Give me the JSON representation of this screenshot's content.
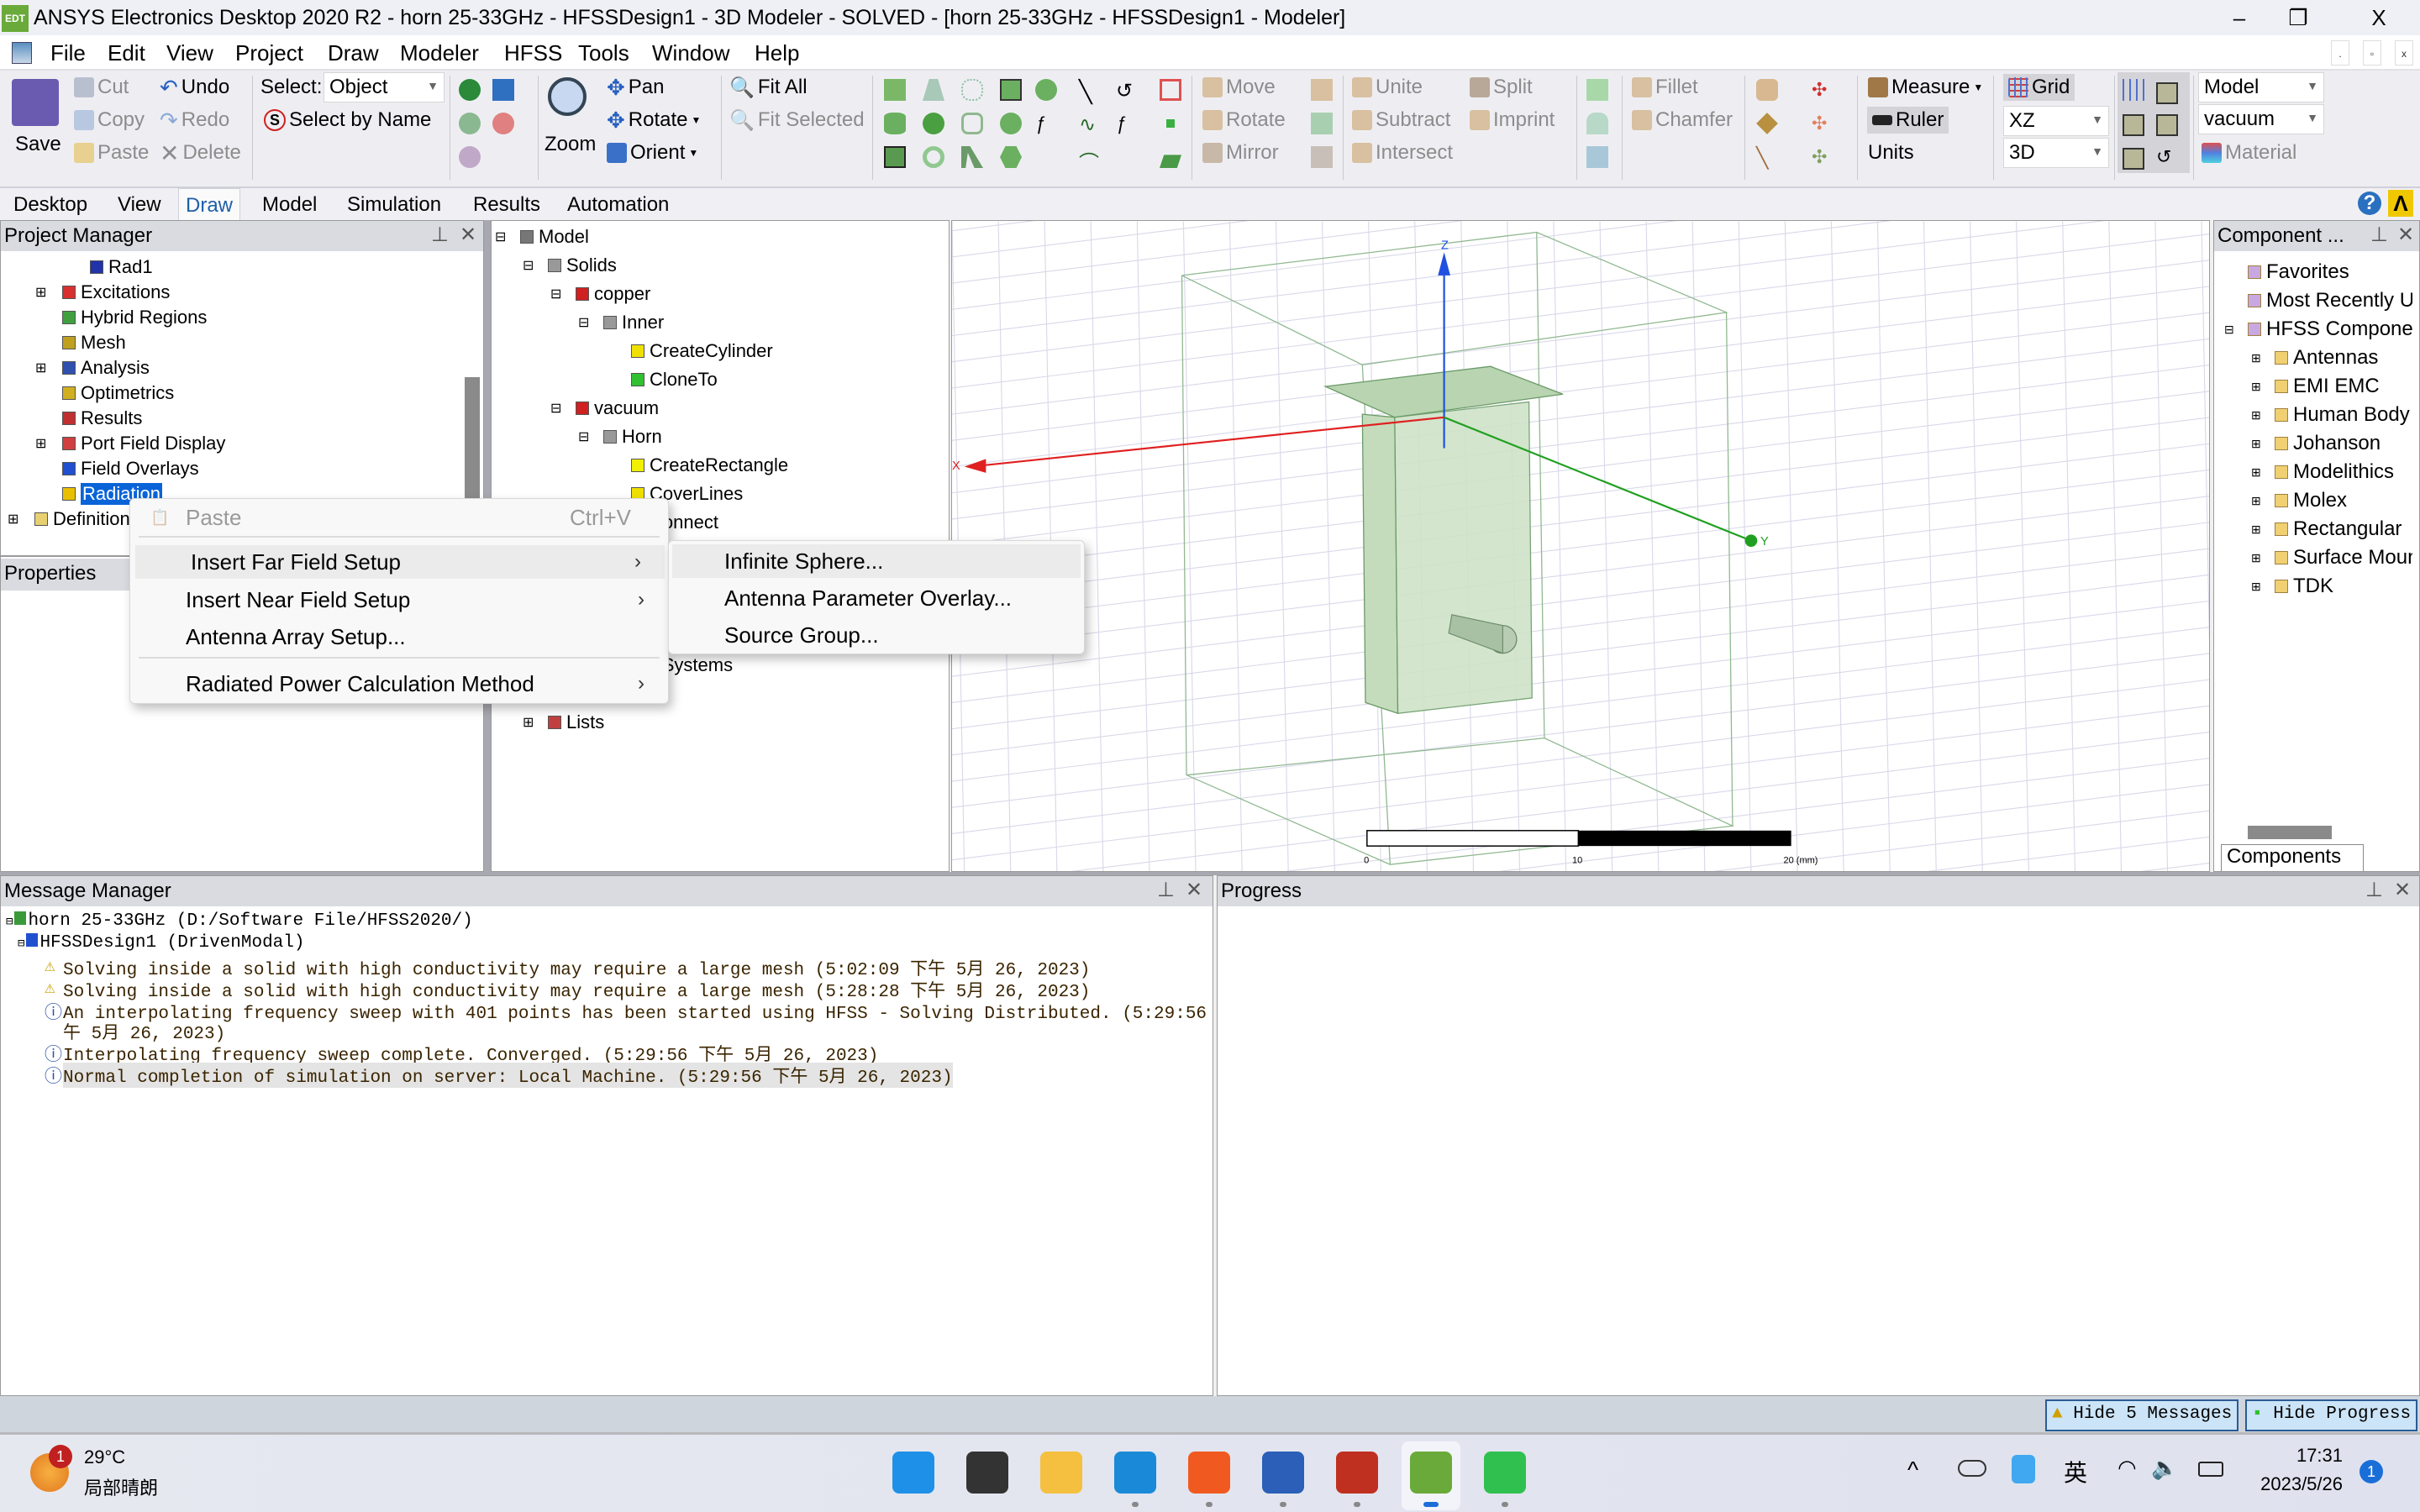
{
  "titlebar": {
    "logo": "EDT",
    "title": "ANSYS Electronics Desktop 2020 R2 - horn 25-33GHz - HFSSDesign1 - 3D Modeler - SOLVED - [horn 25-33GHz - HFSSDesign1 - Modeler]",
    "minimize": "–",
    "restore": "❐",
    "close": "X"
  },
  "menubar": {
    "items": [
      "File",
      "Edit",
      "View",
      "Project",
      "Draw",
      "Modeler",
      "HFSS",
      "Tools",
      "Window",
      "Help"
    ],
    "mdi": [
      ".",
      "▫",
      "x"
    ]
  },
  "ribbon": {
    "save": "Save",
    "cut": "Cut",
    "copy": "Copy",
    "paste": "Paste",
    "undo": "Undo",
    "redo": "Redo",
    "delete": "Delete",
    "select_label": "Select:",
    "select_value": "Object",
    "select_by_name": "Select by Name",
    "zoom": "Zoom",
    "pan": "Pan",
    "rotate": "Rotate",
    "orient": "Orient",
    "fit_all": "Fit All",
    "fit_selected": "Fit Selected",
    "move": "Move",
    "rotate_obj": "Rotate",
    "mirror": "Mirror",
    "unite": "Unite",
    "subtract": "Subtract",
    "intersect": "Intersect",
    "split": "Split",
    "imprint": "Imprint",
    "fillet": "Fillet",
    "chamfer": "Chamfer",
    "measure": "Measure",
    "ruler": "Ruler",
    "units": "Units",
    "grid": "Grid",
    "plane_value": "XZ",
    "dim_value": "3D",
    "view_value": "Model",
    "material_value": "vacuum",
    "material": "Material"
  },
  "tabs": {
    "items": [
      "Desktop",
      "View",
      "Draw",
      "Model",
      "Simulation",
      "Results",
      "Automation"
    ],
    "selected": "Draw"
  },
  "project_manager": {
    "title": "Project Manager",
    "items": [
      {
        "label": "Rad1",
        "depth": 3,
        "icon": "radiation-setup-icon",
        "color": "#2233aa"
      },
      {
        "label": "Excitations",
        "depth": 2,
        "icon": "excitations-icon",
        "color": "#d83030",
        "expand": "+"
      },
      {
        "label": "Hybrid Regions",
        "depth": 2,
        "icon": "hybrid-regions-icon",
        "color": "#40a040"
      },
      {
        "label": "Mesh",
        "depth": 2,
        "icon": "mesh-icon",
        "color": "#c0a020"
      },
      {
        "label": "Analysis",
        "depth": 2,
        "icon": "analysis-icon",
        "color": "#3050b0",
        "expand": "+"
      },
      {
        "label": "Optimetrics",
        "depth": 2,
        "icon": "optimetrics-icon",
        "color": "#d0b020"
      },
      {
        "label": "Results",
        "depth": 2,
        "icon": "results-icon",
        "color": "#c03030"
      },
      {
        "label": "Port Field Display",
        "depth": 2,
        "icon": "port-field-icon",
        "color": "#d04040",
        "expand": "+"
      },
      {
        "label": "Field Overlays",
        "depth": 2,
        "icon": "field-overlays-icon",
        "color": "#2050d0"
      },
      {
        "label": "Radiation",
        "depth": 2,
        "icon": "radiation-icon",
        "color": "#e8c000",
        "selected": true
      },
      {
        "label": "Definitions",
        "depth": 1,
        "icon": "folder-icon",
        "color": "#e8d070",
        "expand": "+"
      }
    ]
  },
  "properties": {
    "title": "Properties"
  },
  "model_tree": {
    "items": [
      {
        "label": "Model",
        "depth": 0,
        "icon": "model-icon",
        "color": "#777",
        "expand": "-"
      },
      {
        "label": "Solids",
        "depth": 1,
        "icon": "solids-icon",
        "color": "#999",
        "expand": "-"
      },
      {
        "label": "copper",
        "depth": 2,
        "icon": "material-icon",
        "color": "#d02020",
        "expand": "-"
      },
      {
        "label": "Inner",
        "depth": 3,
        "icon": "object-icon",
        "color": "#999",
        "expand": "-"
      },
      {
        "label": "CreateCylinder",
        "depth": 4,
        "icon": "cylinder-icon",
        "color": "#f0e000"
      },
      {
        "label": "CloneTo",
        "depth": 4,
        "icon": "clone-icon",
        "color": "#30c030"
      },
      {
        "label": "vacuum",
        "depth": 2,
        "icon": "material-icon",
        "color": "#d02020",
        "expand": "-"
      },
      {
        "label": "Horn",
        "depth": 3,
        "icon": "object-icon",
        "color": "#999",
        "expand": "-"
      },
      {
        "label": "CreateRectangle",
        "depth": 4,
        "icon": "rectangle-icon",
        "color": "#f0f000"
      },
      {
        "label": "CoverLines",
        "depth": 4,
        "icon": "cover-lines-icon",
        "color": "#f0e000"
      },
      {
        "label": "Connect",
        "depth": 4,
        "icon": "connect-icon",
        "color": "#f0e000"
      },
      {
        "label": "",
        "depth": 1
      },
      {
        "label": "",
        "depth": 1
      },
      {
        "label": "",
        "depth": 1
      },
      {
        "label": "",
        "depth": 1
      },
      {
        "label": "Coordinate Systems",
        "depth": 1,
        "icon": "coordinate-systems-icon",
        "color": "#888",
        "expand": "+"
      },
      {
        "label": "",
        "depth": 1
      },
      {
        "label": "Lists",
        "depth": 1,
        "icon": "lists-icon",
        "color": "#c04040",
        "expand": "+"
      }
    ]
  },
  "context_menu": {
    "items": [
      {
        "label": "Paste",
        "shortcut": "Ctrl+V",
        "disabled": true
      },
      {
        "label": "Insert Far Field Setup",
        "submenu": true,
        "hover": true
      },
      {
        "label": "Insert Near Field Setup",
        "submenu": true
      },
      {
        "label": "Antenna Array Setup..."
      },
      {
        "label": "Radiated Power Calculation Method",
        "submenu": true
      }
    ],
    "chevron": "›"
  },
  "submenu": {
    "items": [
      "Infinite Sphere...",
      "Antenna Parameter Overlay...",
      "Source Group..."
    ]
  },
  "viewport": {
    "axes": {
      "x": "X",
      "y": "Y",
      "z": "Z"
    },
    "scale": {
      "ticks": [
        "0",
        "10",
        "20 (mm)"
      ]
    }
  },
  "components": {
    "title": "Component ...",
    "tab": "Components",
    "items": [
      {
        "label": "Favorites",
        "depth": 0
      },
      {
        "label": "Most Recently Used",
        "depth": 0
      },
      {
        "label": "HFSS Components",
        "depth": 0,
        "expand": "-"
      },
      {
        "label": "Antennas",
        "depth": 1,
        "expand": "+"
      },
      {
        "label": "EMI EMC",
        "depth": 1,
        "expand": "+"
      },
      {
        "label": "Human Body",
        "depth": 1,
        "expand": "+"
      },
      {
        "label": "Johanson",
        "depth": 1,
        "expand": "+"
      },
      {
        "label": "Modelithics",
        "depth": 1,
        "expand": "+"
      },
      {
        "label": "Molex",
        "depth": 1,
        "expand": "+"
      },
      {
        "label": "Rectangular",
        "depth": 1,
        "expand": "+"
      },
      {
        "label": "Surface Mount",
        "depth": 1,
        "expand": "+"
      },
      {
        "label": "TDK",
        "depth": 1,
        "expand": "+"
      }
    ]
  },
  "message_manager": {
    "title": "Message Manager",
    "project": "horn 25-33GHz (D:/Software File/HFSS2020/)",
    "design": "HFSSDesign1 (DrivenModal)",
    "messages": [
      {
        "type": "warning",
        "lines": [
          "Solving inside a solid with high conductivity may require a large mesh (5:02:09 下午  5月 26, 2023)"
        ]
      },
      {
        "type": "warning",
        "lines": [
          "Solving inside a solid with high conductivity may require a large mesh (5:28:28 下午  5月 26, 2023)"
        ]
      },
      {
        "type": "info",
        "lines": [
          "An interpolating frequency sweep with 401 points has been started using HFSS - Solving Distributed. (5:29:56 下",
          "午  5月 26, 2023)"
        ]
      },
      {
        "type": "info",
        "lines": [
          "Interpolating frequency sweep complete. Converged. (5:29:56 下午  5月 26, 2023)"
        ]
      },
      {
        "type": "info",
        "lines": [
          "Normal completion of simulation on server: Local Machine. (5:29:56 下午  5月 26, 2023)"
        ],
        "selected": true
      }
    ]
  },
  "progress": {
    "title": "Progress"
  },
  "status": {
    "hide_messages": "Hide 5 Messages",
    "hide_progress": "Hide Progress"
  },
  "taskbar": {
    "weather_temp": "29°C",
    "weather_desc": "局部晴朗",
    "weather_badge": "1",
    "ime": "英",
    "time": "17:31",
    "date": "2023/5/26",
    "notif": "1",
    "apps": [
      {
        "name": "start",
        "color": "#1e90e8"
      },
      {
        "name": "terminal",
        "color": "#333"
      },
      {
        "name": "file-explorer",
        "color": "#f5c040"
      },
      {
        "name": "edge",
        "color": "#1a8ad8"
      },
      {
        "name": "player",
        "color": "#f05a20"
      },
      {
        "name": "word",
        "color": "#2b5fb8"
      },
      {
        "name": "zy",
        "color": "#c03020"
      },
      {
        "name": "ansys-edt",
        "color": "#6aaa3a"
      },
      {
        "name": "wechat",
        "color": "#30c050"
      }
    ]
  }
}
